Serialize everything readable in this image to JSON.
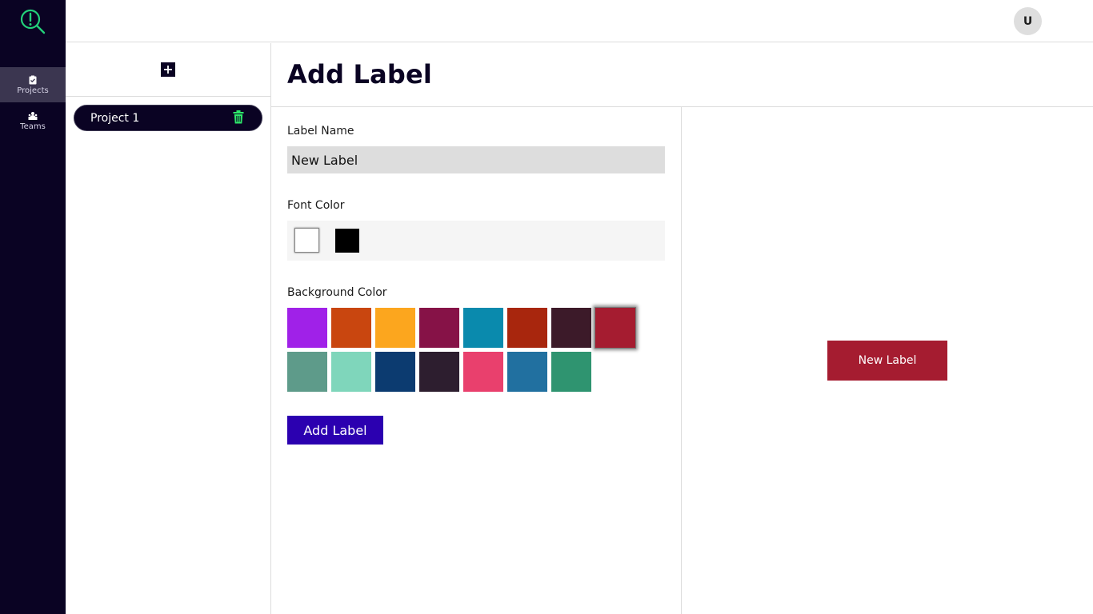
{
  "sidebar": {
    "items": [
      {
        "label": "Projects",
        "icon": "clipboard-check-icon",
        "active": true
      },
      {
        "label": "Teams",
        "icon": "people-icon",
        "active": false
      }
    ]
  },
  "header": {
    "avatar_initial": "U"
  },
  "projects": {
    "add_icon": "plus-icon",
    "items": [
      {
        "name": "Project 1",
        "delete_icon": "trash-icon"
      }
    ]
  },
  "main": {
    "title": "Add Label",
    "label_name": {
      "label": "Label Name",
      "value": "New Label"
    },
    "font_color": {
      "label": "Font Color",
      "options": [
        "#ffffff",
        "#000000"
      ],
      "selected": "#ffffff"
    },
    "background_color": {
      "label": "Background Color",
      "options": [
        "#a021e8",
        "#c9460f",
        "#fca61e",
        "#861247",
        "#0a8aad",
        "#a8260d",
        "#3c1a29",
        "#a51c30",
        "#5e9b8a",
        "#7fd6bb",
        "#0c3b70",
        "#2d1e2f",
        "#e9406d",
        "#2170a0",
        "#2f9470"
      ],
      "selected": "#a51c30"
    },
    "submit_label": "Add Label"
  },
  "preview": {
    "text": "New Label",
    "background": "#a51c30",
    "color": "#ffffff"
  },
  "colors": {
    "sidebar": "#0a0323",
    "accent_button": "#2b00b0",
    "trash": "#2ee86a",
    "logo": "#23d17a"
  }
}
